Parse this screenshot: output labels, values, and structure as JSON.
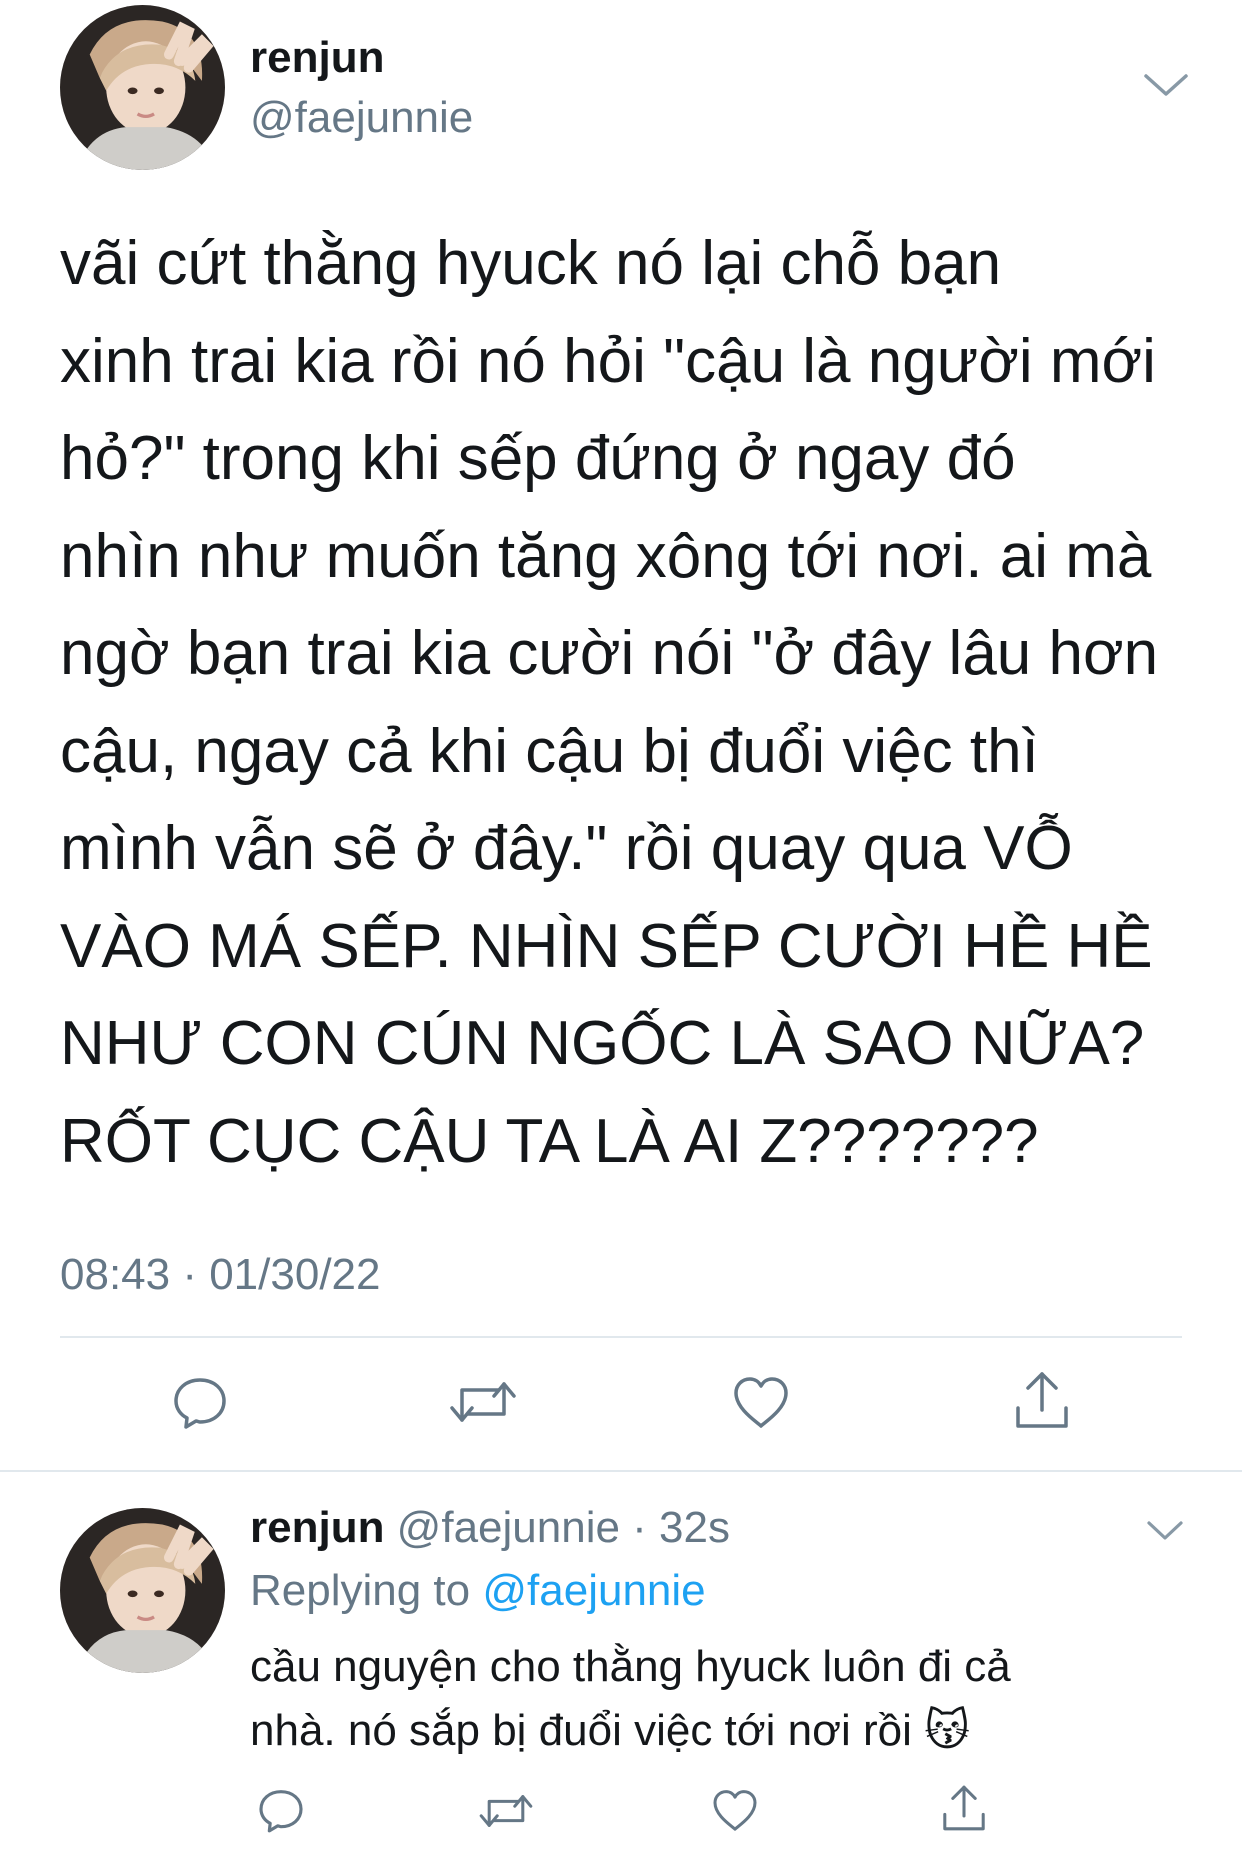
{
  "main_tweet": {
    "display_name": "renjun",
    "handle": "@faejunnie",
    "text": "vãi cứt thằng hyuck nó lại chỗ bạn\nxinh trai kia rồi nó hỏi \"cậu là người mới\nhỏ?\" trong khi sếp đứng ở ngay đó\nnhìn như muốn tăng xông tới nơi. ai mà\nngờ bạn trai kia cười nói \"ở đây lâu hơn\ncậu, ngay cả khi cậu bị đuổi việc thì\nmình vẫn sẽ ở đây.\" rồi quay qua VỖ\nVÀO MÁ SẾP. NHÌN SẾP CƯỜI HỀ HỀ\nNHƯ CON CÚN NGỐC LÀ SAO NỮA?\nRỐT CỤC CẬU TA LÀ AI Z???????",
    "timestamp": "08:43 · 01/30/22",
    "actions": [
      "reply-icon",
      "retweet-icon",
      "like-icon",
      "share-icon"
    ]
  },
  "reply_tweet": {
    "display_name": "renjun",
    "meta": " @faejunnie · 32s",
    "replying_prefix": "Replying to ",
    "replying_to": "@faejunnie",
    "text": "cầu nguyện cho thằng hyuck luôn đi cả\nnhà. nó sắp bị đuổi việc tới nơi rồi 😽",
    "actions": [
      "reply-icon",
      "retweet-icon",
      "like-icon",
      "share-icon"
    ]
  },
  "colors": {
    "text": "#14171a",
    "secondary": "#657786",
    "accent": "#1da1f2",
    "divider": "#e1e8ed"
  }
}
